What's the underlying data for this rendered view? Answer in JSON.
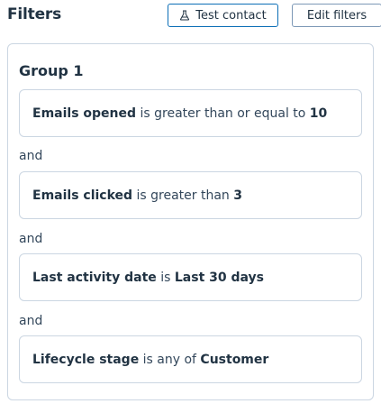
{
  "header": {
    "title": "Filters",
    "test_button_label": "Test contact",
    "edit_button_label": "Edit filters"
  },
  "group": {
    "title": "Group 1",
    "conjunction": "and",
    "filters": [
      {
        "property": "Emails opened",
        "operator": "is greater than or equal to",
        "value": "10"
      },
      {
        "property": "Emails clicked",
        "operator": "is greater than",
        "value": "3"
      },
      {
        "property": "Last activity date",
        "operator": "is",
        "value": "Last 30 days"
      },
      {
        "property": "Lifecycle stage",
        "operator": "is any of",
        "value": "Customer"
      }
    ]
  },
  "colors": {
    "accent": "#0b6eb6",
    "border": "#cbd6e2",
    "text": "#33475b",
    "heading": "#213343"
  }
}
